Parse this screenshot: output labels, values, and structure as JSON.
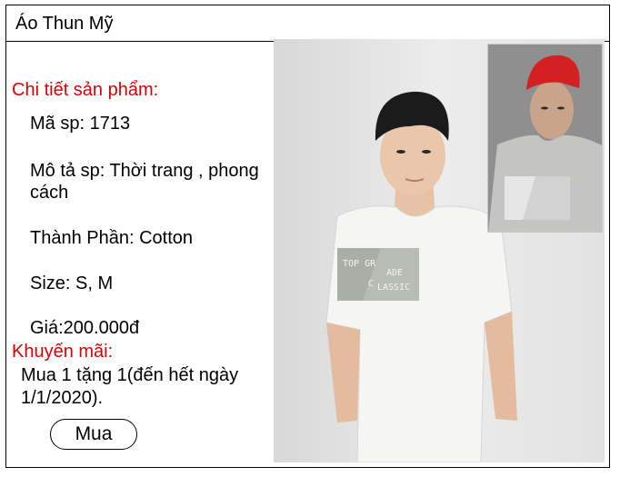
{
  "window": {
    "title": "Áo Thun Mỹ"
  },
  "details": {
    "heading": "Chi tiết sản phẩm:",
    "code": "Mã sp: 1713",
    "description": "Mô tả sp: Thời trang , phong cách",
    "material": "Thành Phần: Cotton",
    "size": "Size: S, M",
    "price": "Giá:200.000đ"
  },
  "promotion": {
    "heading": "Khuyến mãi:",
    "text": "Mua 1 tặng 1(đến hết ngày 1/1/2020)."
  },
  "actions": {
    "buy_label": "Mua"
  },
  "shirt_print": {
    "line1": "TOP GR",
    "line2": "ADE",
    "line3": "C",
    "line4": "LASSIC"
  },
  "colors": {
    "heading": "#e10000",
    "border": "#000000",
    "cap": "#d42020"
  }
}
